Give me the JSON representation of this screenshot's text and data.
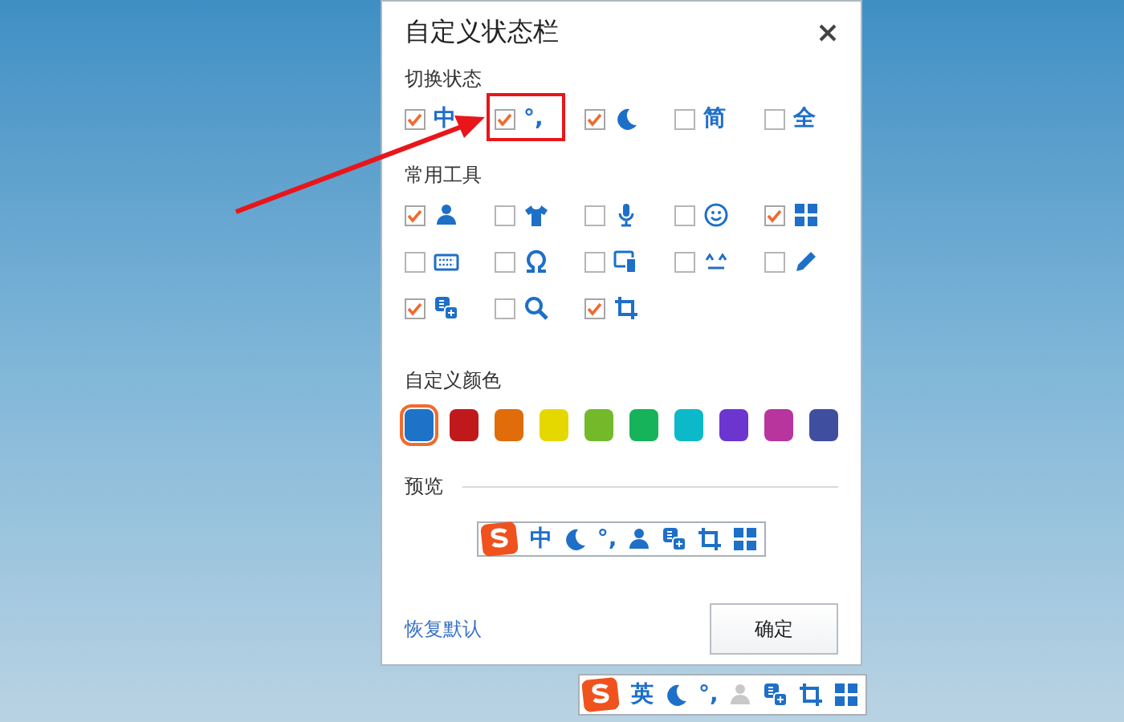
{
  "dialog": {
    "title": "自定义状态栏",
    "sections": [
      {
        "heading": "切换状态",
        "items": [
          {
            "kind": "text",
            "label": "中",
            "checked": true
          },
          {
            "kind": "text",
            "label": "°,",
            "checked": true
          },
          {
            "kind": "icon",
            "checked": true
          },
          {
            "kind": "text",
            "label": "简",
            "checked": false
          },
          {
            "kind": "text",
            "label": "全",
            "checked": false
          }
        ]
      },
      {
        "heading": "常用工具",
        "items": [
          {
            "kind": "icon",
            "checked": true
          },
          {
            "kind": "icon",
            "checked": false
          },
          {
            "kind": "icon",
            "checked": false
          },
          {
            "kind": "icon",
            "checked": false
          },
          {
            "kind": "icon",
            "checked": true
          },
          {
            "kind": "icon",
            "checked": false
          },
          {
            "kind": "icon",
            "checked": false
          },
          {
            "kind": "icon",
            "checked": false
          },
          {
            "kind": "icon",
            "checked": false
          },
          {
            "kind": "icon",
            "checked": false
          },
          {
            "kind": "icon",
            "checked": true
          },
          {
            "kind": "icon",
            "checked": false
          },
          {
            "kind": "icon",
            "checked": true
          }
        ]
      }
    ],
    "colors": {
      "heading": "自定义颜色",
      "swatches": [
        {
          "color": "#1e73c9",
          "selected": true
        },
        {
          "color": "#c0191b",
          "selected": false
        },
        {
          "color": "#e06c0a",
          "selected": false
        },
        {
          "color": "#e5d800",
          "selected": false
        },
        {
          "color": "#74b92a",
          "selected": false
        },
        {
          "color": "#16b35a",
          "selected": false
        },
        {
          "color": "#0bb9c9",
          "selected": false
        },
        {
          "color": "#6c35cf",
          "selected": false
        },
        {
          "color": "#b7359c",
          "selected": false
        },
        {
          "color": "#3f4e9f",
          "selected": false
        }
      ]
    },
    "preview": {
      "heading": "预览",
      "items": [
        {
          "kind": "text",
          "label": "中"
        },
        {
          "kind": "icon"
        },
        {
          "kind": "text",
          "label": "°,"
        },
        {
          "kind": "icon"
        },
        {
          "kind": "icon"
        },
        {
          "kind": "icon"
        },
        {
          "kind": "icon"
        }
      ]
    },
    "footer": {
      "reset_link": "恢复默认",
      "ok_button": "确定"
    }
  },
  "status_bar": {
    "items": [
      {
        "kind": "text",
        "label": "英",
        "disabled": false
      },
      {
        "kind": "icon",
        "disabled": false
      },
      {
        "kind": "text",
        "label": "°,",
        "disabled": false
      },
      {
        "kind": "icon",
        "disabled": true
      },
      {
        "kind": "icon",
        "disabled": false
      },
      {
        "kind": "icon",
        "disabled": false
      },
      {
        "kind": "icon",
        "disabled": false
      }
    ]
  }
}
